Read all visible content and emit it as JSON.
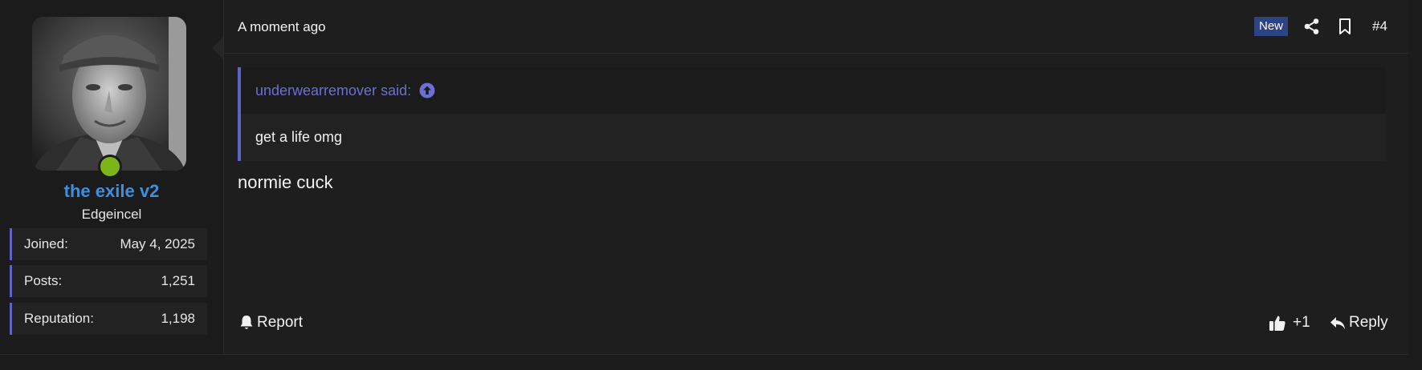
{
  "user": {
    "name": "the exile v2",
    "title": "Edgeincel",
    "stats": [
      {
        "label": "Joined:",
        "value": "May 4, 2025"
      },
      {
        "label": "Posts:",
        "value": "1,251"
      },
      {
        "label": "Reputation:",
        "value": "1,198"
      }
    ],
    "online": true
  },
  "post": {
    "timestamp": "A moment ago",
    "badge": "New",
    "number": "#4",
    "quote": {
      "author_line": "underwearremover said:",
      "text": "get a life omg"
    },
    "message": "normie cuck"
  },
  "footer": {
    "report_label": "Report",
    "like_label": "+1",
    "reply_label": "Reply"
  },
  "colors": {
    "accent": "#5f64c3",
    "username": "#3d8fe0",
    "online": "#7cb518",
    "badge": "#2c4483"
  }
}
